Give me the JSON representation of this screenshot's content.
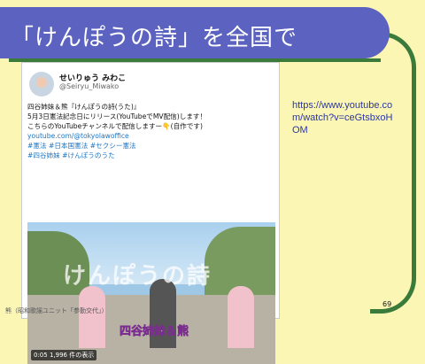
{
  "slide": {
    "title": "「けんぽうの詩」を全国で",
    "url": "https://www.youtube.com/watch?v=ceGtsbxoHOM",
    "page_number": "69"
  },
  "tweet": {
    "display_name": "せいりゅう みわこ",
    "user_id": "@Seiryu_Miwako",
    "lines": [
      "四谷姉妹＆熊『けんぽうの詩(うた)』",
      "5月3日憲法記念日にリリース(YouTubeでMV配信)します！",
      "こちらのYouTubeチャンネルで配信しますー👇(自作です)",
      "youtube.com/@tokyolawoffice",
      "#憲法 #日本国憲法 #セクシー憲法",
      "#四谷姉妹 #けんぽうのうた"
    ],
    "video_overlay_title": "けんぽうの詩",
    "video_overlay_subtitle": "四谷姉妹＆熊",
    "video_time": "0:05",
    "video_views": "1,996 件の表示",
    "footer": "熊（昭和歌謡ユニット「参勤交代」）"
  },
  "colors": {
    "background": "#fbf6b4",
    "title_bar": "#5b62bf",
    "accent_green": "#3a7a3a",
    "link": "#1d75c4",
    "url": "#2a36a8"
  }
}
